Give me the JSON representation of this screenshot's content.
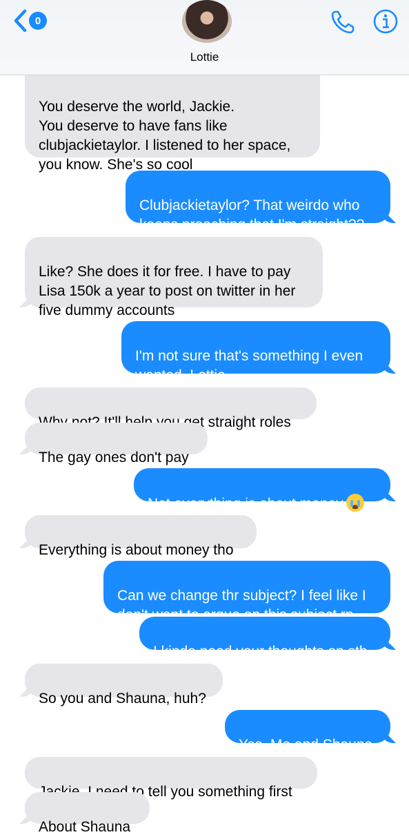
{
  "header": {
    "back_badge": "0",
    "contact_name": "Lottie"
  },
  "messages": [
    {
      "dir": "recv",
      "text": "You deserve the world, Jackie.\nYou deserve to have fans like\nclubjackietaylor. I listened to her space,\nyou know. She's so cool"
    },
    {
      "dir": "sent",
      "text": "Clubjackietaylor? That weirdo who\nkeeps preaching that I'm straight??"
    },
    {
      "dir": "recv",
      "text": "Like? She does it for free. I have to pay\nLisa 150k a year to post on twitter in her\nfive dummy accounts"
    },
    {
      "dir": "sent",
      "text": "I'm not sure that's something I even\nwanted, Lottie"
    },
    {
      "dir": "recv",
      "text": "Why not? It'll help you get straight roles"
    },
    {
      "dir": "recv",
      "text": "The gay ones don't pay"
    },
    {
      "dir": "sent",
      "text": "Not everything is about money",
      "emoji": "loudly-crying-face"
    },
    {
      "dir": "recv",
      "text": "Everything is about money tho"
    },
    {
      "dir": "sent",
      "text": "Can we change thr subject? I feel like I\ndon't want to argue on this subject rn"
    },
    {
      "dir": "sent",
      "text": "I kinda need your thoughts on sth"
    },
    {
      "dir": "recv",
      "text": "So you and Shauna, huh?"
    },
    {
      "dir": "sent",
      "text": "Yes. Me and Shauna"
    },
    {
      "dir": "recv",
      "text": "Jackie. I need to tell you something first"
    },
    {
      "dir": "recv",
      "text": "About Shauna"
    }
  ]
}
